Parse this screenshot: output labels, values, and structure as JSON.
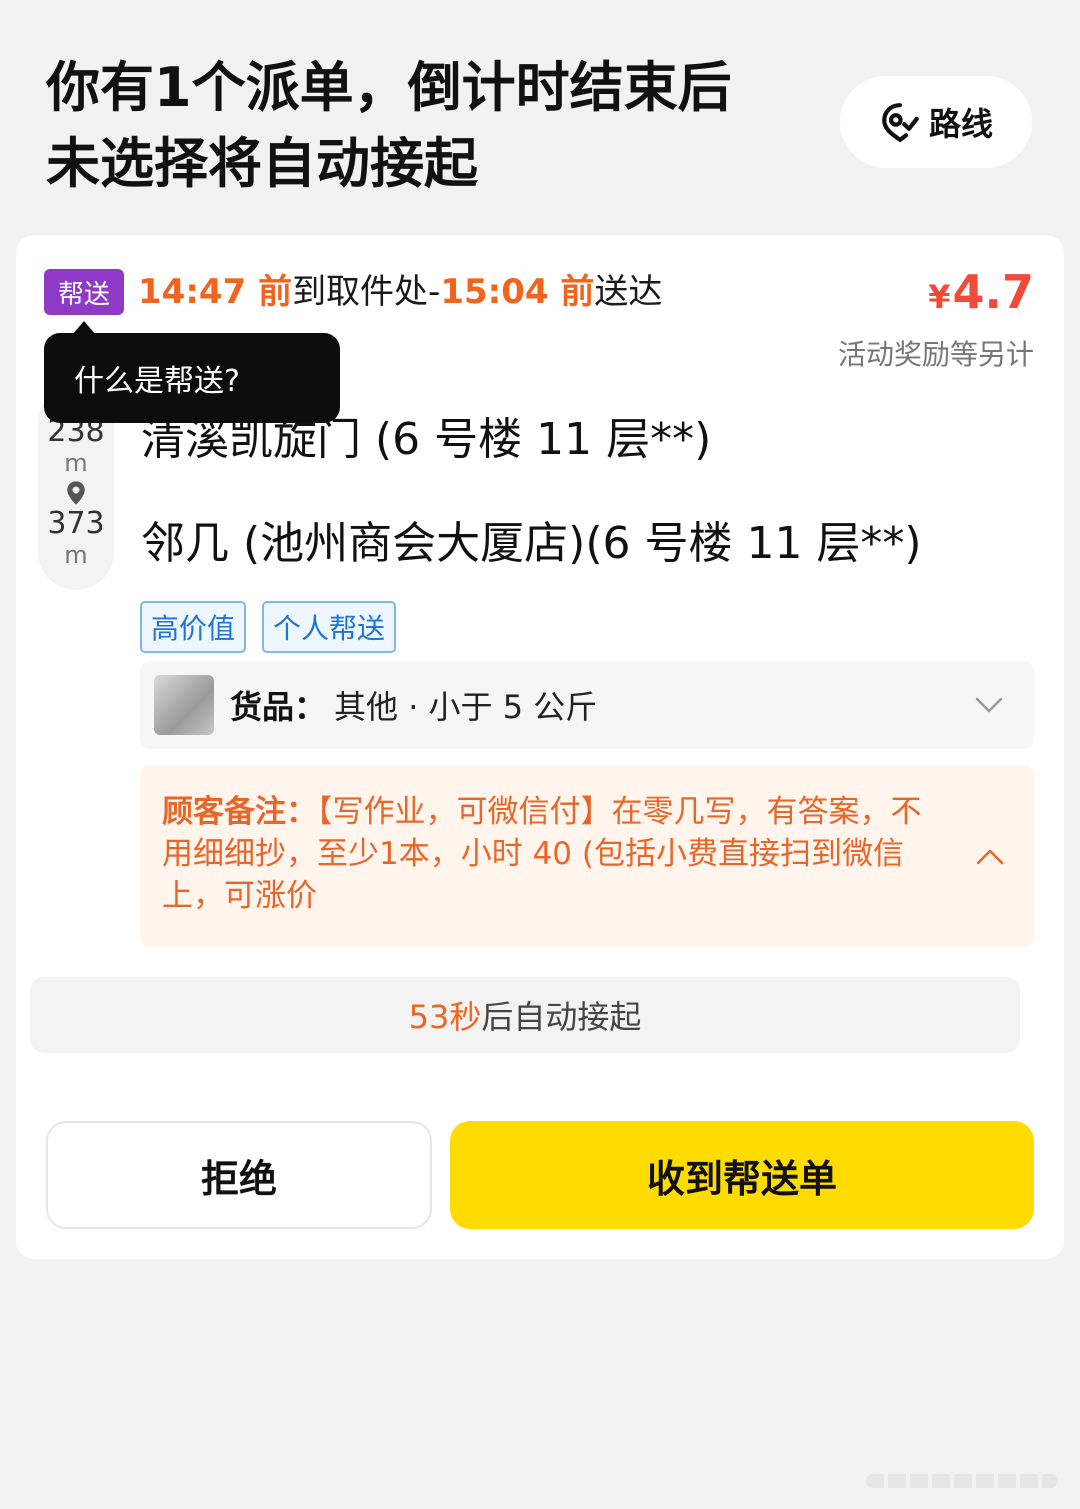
{
  "header": {
    "title_line1": "你有1个派单，倒计时结束后",
    "title_line2": "未选择将自动接起",
    "route_label": "路线"
  },
  "order": {
    "type_tag": "帮送",
    "pickup_time": "14:47 前",
    "pickup_text": "到取件处-",
    "deliver_time": "15:04 前",
    "deliver_text": "送达",
    "price_currency": "¥",
    "price_value": "4.7",
    "price_note": "活动奖励等另计",
    "tooltip": "什么是帮送?",
    "distance1": "238",
    "distance1_unit": "m",
    "distance2": "373",
    "distance2_unit": "m",
    "pickup_address": "清溪凯旋门 (6 号楼 11 层**)",
    "dropoff_address": "邻几 (池州商会大厦店)(6 号楼 11 层**)",
    "chips": [
      "高价值",
      "个人帮送"
    ],
    "goods_label": "货品：",
    "goods_value": "其他 · 小于 5 公斤",
    "remark_label": "顾客备注：",
    "remark_text": "【写作业，可微信付】在零几写，有答案，不用细细抄，至少1本，小时 40 (包括小费直接扫到微信上，可涨价"
  },
  "countdown": {
    "seconds": "53秒",
    "text": "后自动接起"
  },
  "actions": {
    "reject": "拒绝",
    "accept": "收到帮送单"
  },
  "colors": {
    "accent_orange": "#f0641e",
    "price_red": "#f24a3a",
    "tag_purple": "#8e3ac7",
    "accept_yellow": "#ffdc00"
  }
}
